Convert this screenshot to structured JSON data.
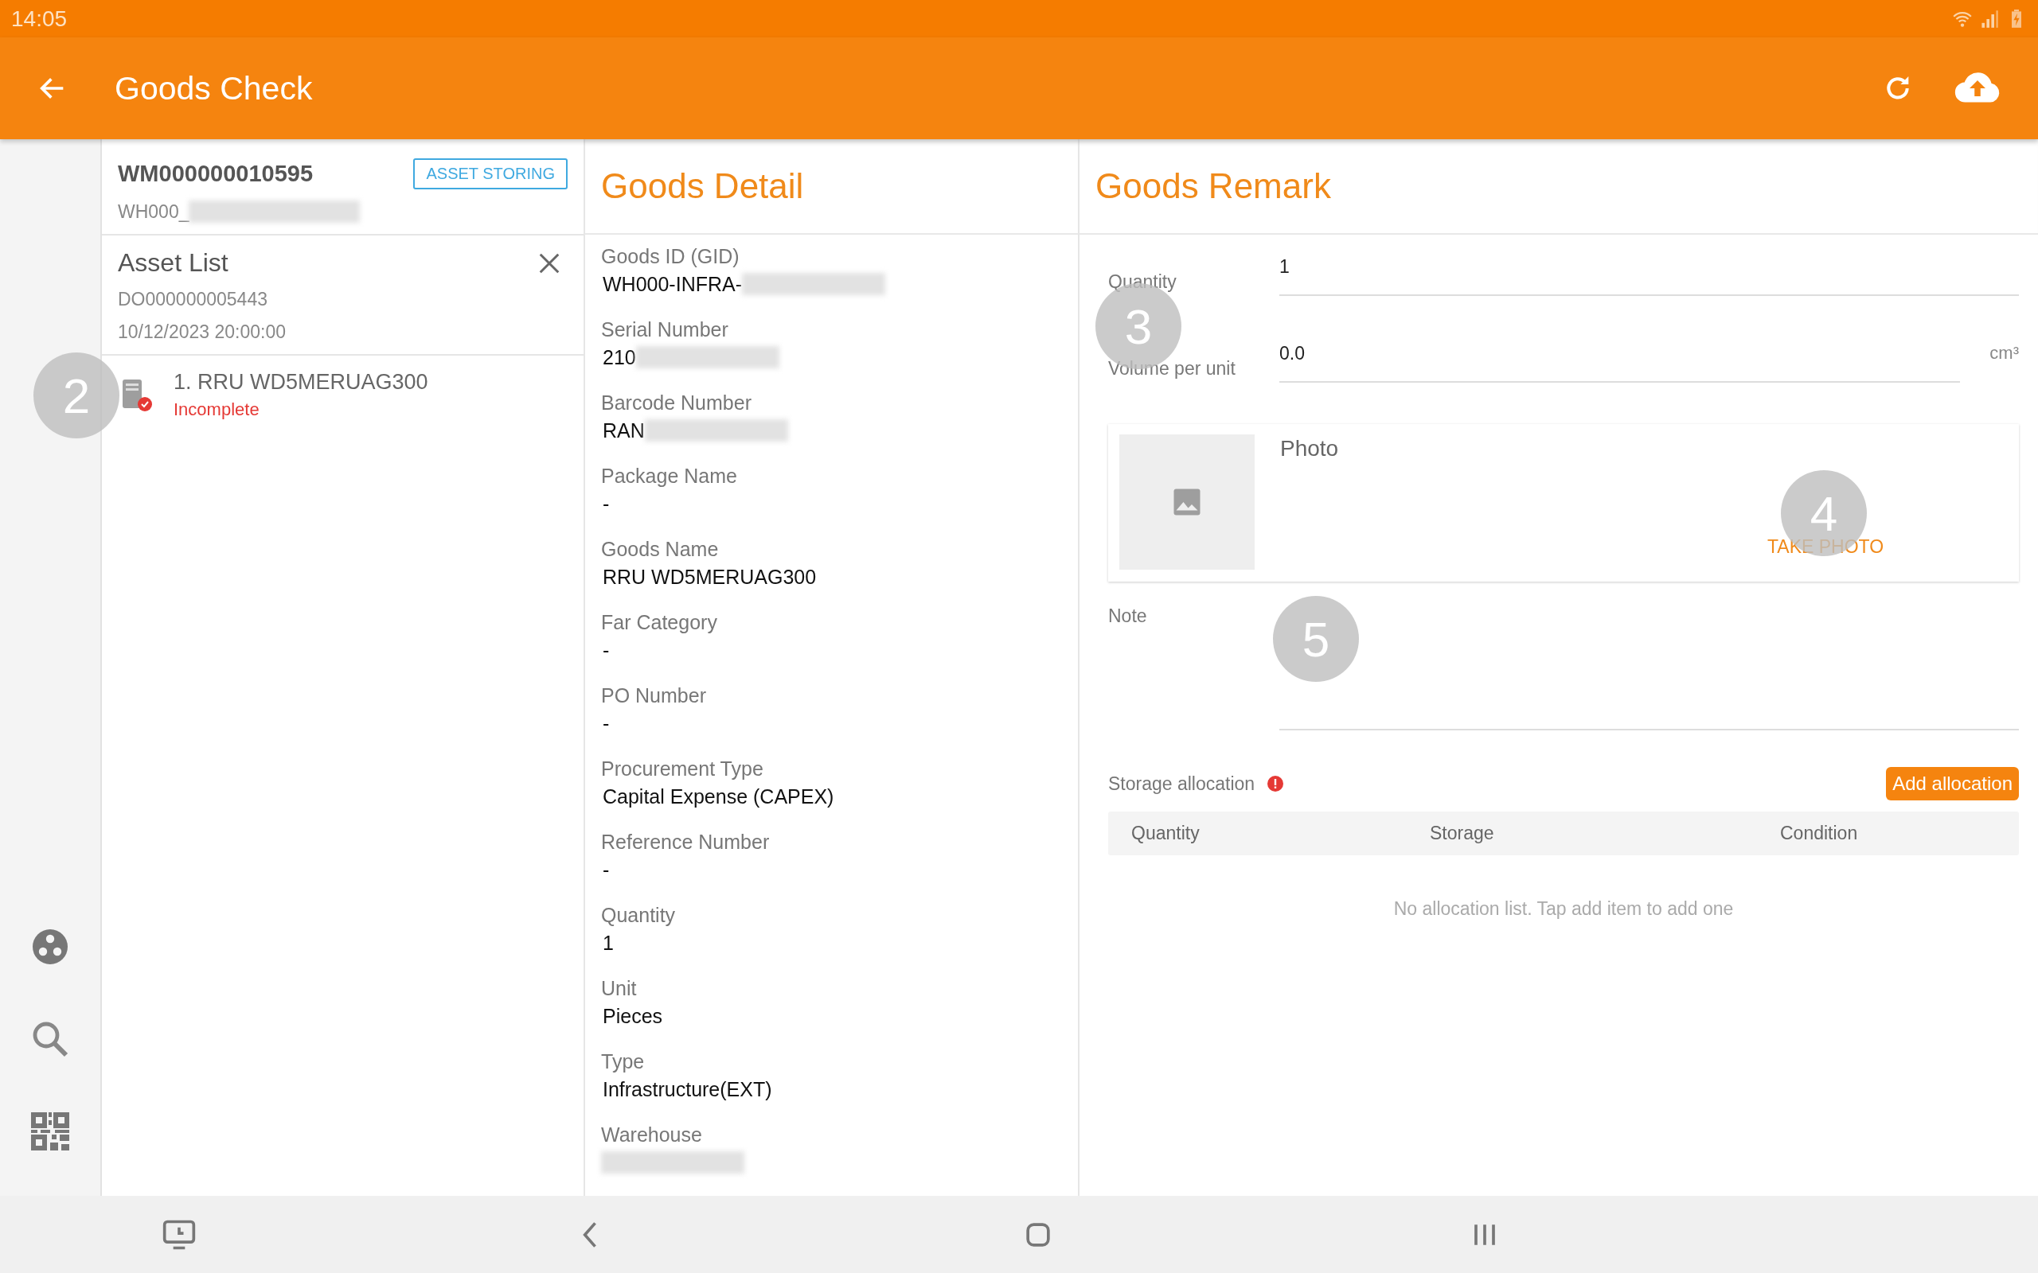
{
  "status_bar": {
    "time": "14:05"
  },
  "app_bar": {
    "title": "Goods Check"
  },
  "order": {
    "number": "WM000000010595",
    "badge": "ASSET STORING",
    "warehouse": "WH000_",
    "warehouse_blurred": true
  },
  "asset_list": {
    "title": "Asset List",
    "document": "DO000000005443",
    "date": "10/12/2023 20:00:00",
    "items": [
      {
        "title": "1. RRU WD5MERUAG300",
        "status": "Incomplete",
        "complete": false,
        "annotation": "2"
      }
    ]
  },
  "goods_detail": {
    "title": "Goods Detail",
    "fields": [
      {
        "label": "Goods ID (GID)",
        "value": "WH000-INFRA-",
        "blurred": true
      },
      {
        "label": "Serial Number",
        "value": "210",
        "blurred": true
      },
      {
        "label": "Barcode Number",
        "value": "RAN",
        "blurred": true
      },
      {
        "label": "Package Name",
        "value": "-",
        "blurred": false
      },
      {
        "label": "Goods Name",
        "value": "RRU WD5MERUAG300",
        "blurred": false
      },
      {
        "label": "Far Category",
        "value": "-",
        "blurred": false
      },
      {
        "label": "PO Number",
        "value": "-",
        "blurred": false
      },
      {
        "label": "Procurement Type",
        "value": "Capital Expense (CAPEX)",
        "blurred": false
      },
      {
        "label": "Reference Number",
        "value": "-",
        "blurred": false
      },
      {
        "label": "Quantity",
        "value": "1",
        "blurred": false
      },
      {
        "label": "Unit",
        "value": "Pieces",
        "blurred": false
      },
      {
        "label": "Type",
        "value": "Infrastructure(EXT)",
        "blurred": false
      },
      {
        "label": "Warehouse",
        "blurred": true
      }
    ]
  },
  "goods_remark": {
    "title": "Goods Remark",
    "quantity": {
      "label": "Quantity",
      "value": "1"
    },
    "volume": {
      "label": "Volume per unit",
      "value": "0.0",
      "unit": "cm³",
      "annotation": "3"
    },
    "photo": {
      "title": "Photo",
      "action": "TAKE PHOTO",
      "annotation": "4"
    },
    "note": {
      "label": "Note",
      "annotation": "5"
    },
    "storage": {
      "label": "Storage allocation",
      "warning": true,
      "button": "Add allocation",
      "columns": [
        "Quantity",
        "Storage",
        "Condition"
      ],
      "empty_text": "No allocation list. Tap add item to add one"
    }
  }
}
